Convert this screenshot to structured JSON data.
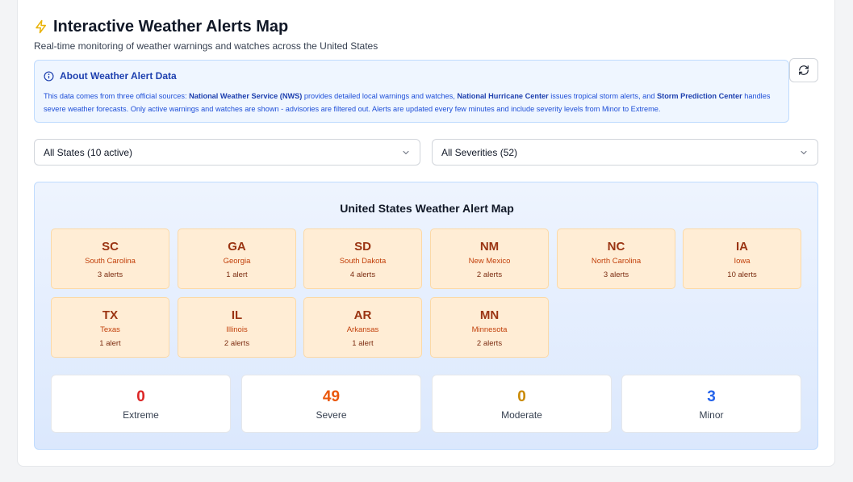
{
  "header": {
    "title": "Interactive Weather Alerts Map",
    "subtitle": "Real-time monitoring of weather warnings and watches across the United States",
    "title_icon": "lightning-bolt-icon"
  },
  "info": {
    "title": "About Weather Alert Data",
    "text_1": "This data comes from three official sources: ",
    "nws": "National Weather Service (NWS)",
    "text_2": " provides detailed local warnings and watches, ",
    "nhc": "National Hurricane Center",
    "text_3": " issues tropical storm alerts, and ",
    "spc": "Storm Prediction Center",
    "text_4": " handles severe weather forecasts. Only active warnings and watches are shown - advisories are filtered out. Alerts are updated every few minutes and include severity levels from Minor to Extreme."
  },
  "filters": {
    "states_value": "All States (10 active)",
    "severity_value": "All Severities (52)"
  },
  "map": {
    "title": "United States Weather Alert Map",
    "states": [
      {
        "abbr": "SC",
        "name": "South Carolina",
        "count": "3 alerts"
      },
      {
        "abbr": "GA",
        "name": "Georgia",
        "count": "1 alert"
      },
      {
        "abbr": "SD",
        "name": "South Dakota",
        "count": "4 alerts"
      },
      {
        "abbr": "NM",
        "name": "New Mexico",
        "count": "2 alerts"
      },
      {
        "abbr": "NC",
        "name": "North Carolina",
        "count": "3 alerts"
      },
      {
        "abbr": "IA",
        "name": "Iowa",
        "count": "10 alerts"
      },
      {
        "abbr": "TX",
        "name": "Texas",
        "count": "1 alert"
      },
      {
        "abbr": "IL",
        "name": "Illinois",
        "count": "2 alerts"
      },
      {
        "abbr": "AR",
        "name": "Arkansas",
        "count": "1 alert"
      },
      {
        "abbr": "MN",
        "name": "Minnesota",
        "count": "2 alerts"
      }
    ]
  },
  "severity": [
    {
      "count": "0",
      "label": "Extreme",
      "color": "#dc2626"
    },
    {
      "count": "49",
      "label": "Severe",
      "color": "#ea580c"
    },
    {
      "count": "0",
      "label": "Moderate",
      "color": "#ca8a04"
    },
    {
      "count": "3",
      "label": "Minor",
      "color": "#2563eb"
    }
  ],
  "colors": {
    "accent": "#eab308",
    "info_blue": "#1d4ed8",
    "tile_bg": "#ffedd5",
    "tile_text": "#9a3412"
  }
}
